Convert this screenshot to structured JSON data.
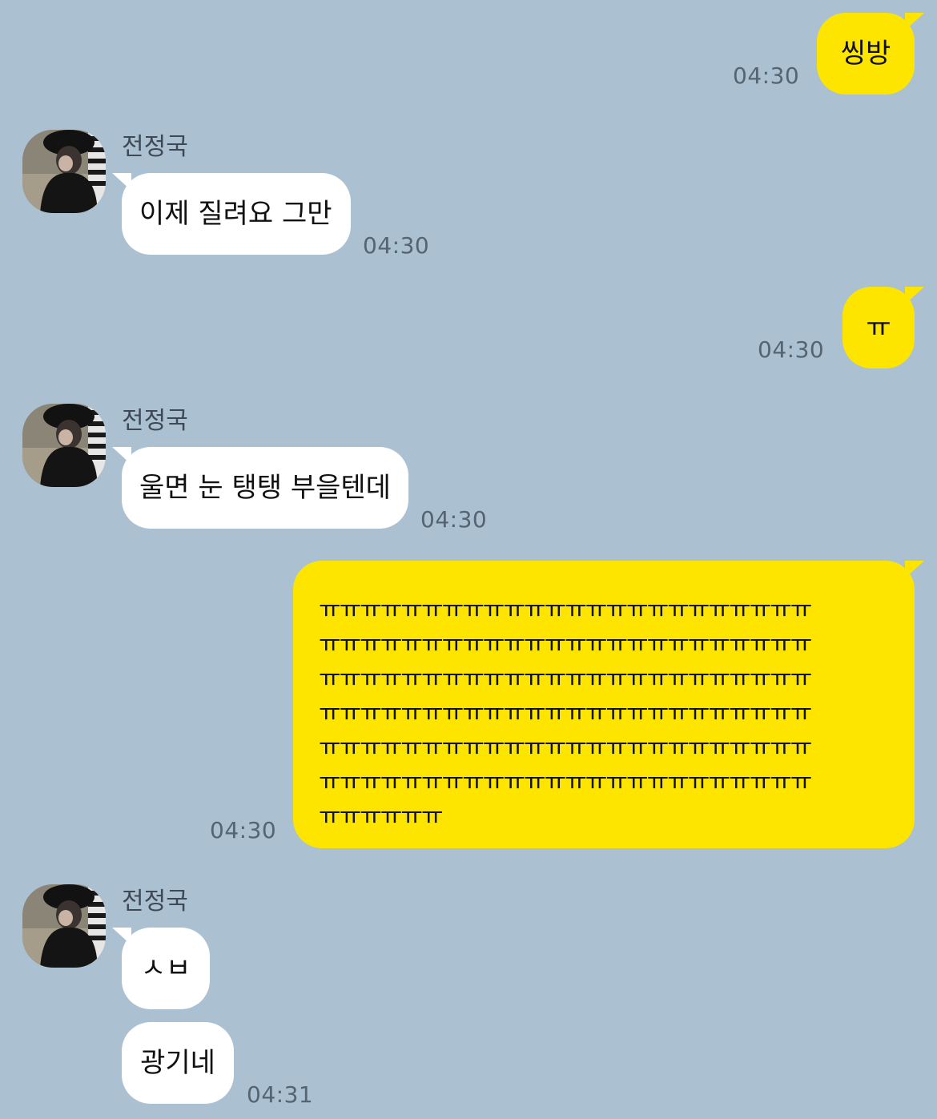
{
  "contact": {
    "name": "전정국",
    "avatar": "contact-photo-icon"
  },
  "colors": {
    "background": "#abc1d1",
    "outgoing_bubble": "#fee500",
    "incoming_bubble": "#ffffff",
    "time_text": "#556471"
  },
  "messages": [
    {
      "direction": "outgoing",
      "text": "씽방",
      "time": "04:30"
    },
    {
      "direction": "incoming",
      "sender": "전정국",
      "text": "이제 질려요 그만",
      "time": "04:30"
    },
    {
      "direction": "outgoing",
      "text": "ㅠ",
      "time": "04:30"
    },
    {
      "direction": "incoming",
      "sender": "전정국",
      "text": "울면 눈 탱탱 부을텐데",
      "time": "04:30"
    },
    {
      "direction": "outgoing",
      "text": "ㅠㅠㅠㅠㅠㅠㅠㅠㅠㅠㅠㅠㅠㅠㅠㅠㅠㅠㅠㅠㅠㅠㅠㅠ\nㅠㅠㅠㅠㅠㅠㅠㅠㅠㅠㅠㅠㅠㅠㅠㅠㅠㅠㅠㅠㅠㅠㅠㅠ\nㅠㅠㅠㅠㅠㅠㅠㅠㅠㅠㅠㅠㅠㅠㅠㅠㅠㅠㅠㅠㅠㅠㅠㅠ\nㅠㅠㅠㅠㅠㅠㅠㅠㅠㅠㅠㅠㅠㅠㅠㅠㅠㅠㅠㅠㅠㅠㅠㅠ\nㅠㅠㅠㅠㅠㅠㅠㅠㅠㅠㅠㅠㅠㅠㅠㅠㅠㅠㅠㅠㅠㅠㅠㅠ\nㅠㅠㅠㅠㅠㅠㅠㅠㅠㅠㅠㅠㅠㅠㅠㅠㅠㅠㅠㅠㅠㅠㅠㅠ\nㅠㅠㅠㅠㅠㅠ",
      "time": "04:30"
    },
    {
      "direction": "incoming",
      "sender": "전정국",
      "text": "ㅅㅂ"
    },
    {
      "direction": "incoming",
      "text": "광기네",
      "time": "04:31"
    }
  ]
}
